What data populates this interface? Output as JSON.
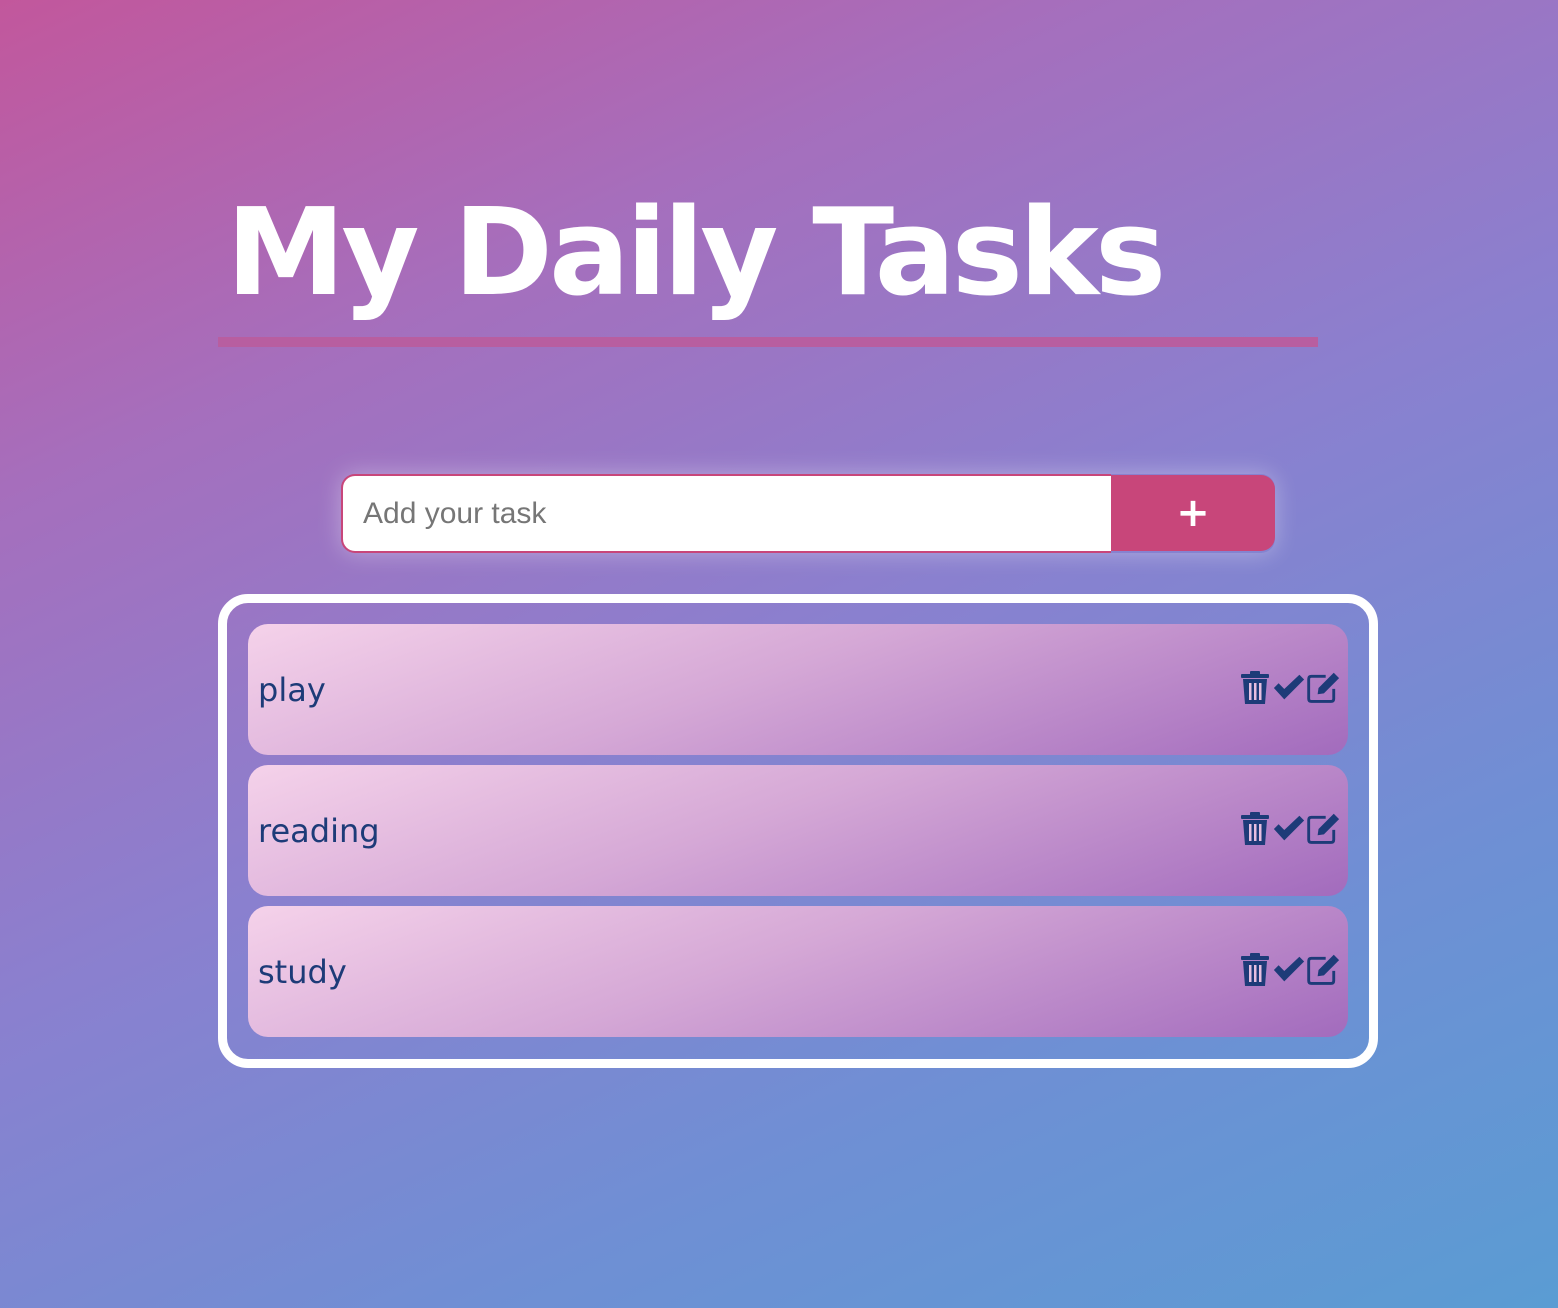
{
  "header": {
    "title": "My Daily Tasks"
  },
  "add_task": {
    "placeholder": "Add your task",
    "value": "",
    "button_label": "+"
  },
  "tasks": [
    {
      "label": "play"
    },
    {
      "label": "reading"
    },
    {
      "label": "study"
    }
  ],
  "icons": {
    "delete": "trash-icon",
    "complete": "check-icon",
    "edit": "edit-icon"
  },
  "colors": {
    "accent": "#c8467a",
    "task_text": "#1d3b78",
    "icon": "#1d3b78",
    "title": "#ffffff"
  }
}
